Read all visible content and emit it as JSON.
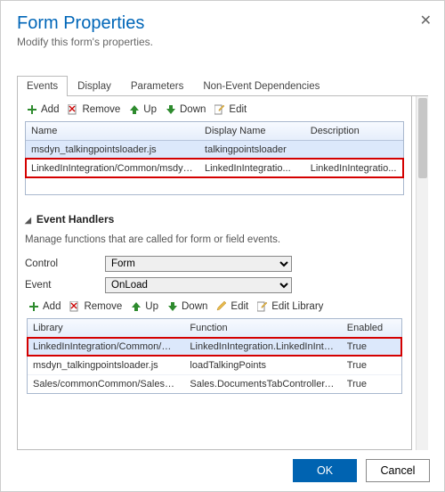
{
  "header": {
    "title": "Form Properties",
    "subtitle": "Modify this form's properties."
  },
  "tabs": [
    "Events",
    "Display",
    "Parameters",
    "Non-Event Dependencies"
  ],
  "formLib": {
    "toolbar": {
      "add": "Add",
      "remove": "Remove",
      "up": "Up",
      "down": "Down",
      "edit": "Edit"
    },
    "columns": [
      "Name",
      "Display Name",
      "Description"
    ],
    "rows": [
      {
        "name": "msdyn_talkingpointsloader.js",
        "display": "talkingpointsloader",
        "desc": ""
      },
      {
        "name": "LinkedInIntegration/Common/msdyn_L...",
        "display": "LinkedInIntegratio...",
        "desc": "LinkedInIntegratio..."
      }
    ]
  },
  "eventHandlers": {
    "heading": "Event Handlers",
    "description": "Manage functions that are called for form or field events.",
    "controlLabel": "Control",
    "controlValue": "Form",
    "eventLabel": "Event",
    "eventValue": "OnLoad",
    "toolbar": {
      "add": "Add",
      "remove": "Remove",
      "up": "Up",
      "down": "Down",
      "edit": "Edit",
      "editLibrary": "Edit Library"
    },
    "columns": [
      "Library",
      "Function",
      "Enabled"
    ],
    "rows": [
      {
        "library": "LinkedInIntegration/Common/msdyn_L...",
        "func": "LinkedInIntegration.LinkedInIntegration...",
        "enabled": "True"
      },
      {
        "library": "msdyn_talkingpointsloader.js",
        "func": "loadTalkingPoints",
        "enabled": "True"
      },
      {
        "library": "Sales/commonCommon/Sales_ClientCom...",
        "func": "Sales.DocumentsTabController.shouldS...",
        "enabled": "True"
      }
    ]
  },
  "footer": {
    "ok": "OK",
    "cancel": "Cancel"
  }
}
